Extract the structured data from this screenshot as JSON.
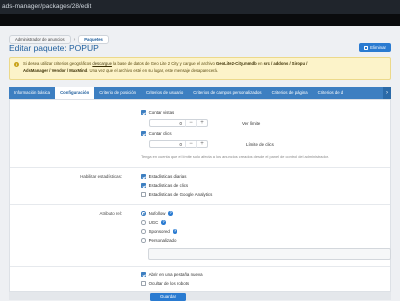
{
  "browser": {
    "url": "ads-manager/packages/28/edit"
  },
  "breadcrumb": {
    "items": [
      "Administrador de anuncios",
      "Paquetes"
    ]
  },
  "page": {
    "title": "Editar paquete: POPUP",
    "delete_label": "Eliminar"
  },
  "notice": {
    "part1": "Si desea utilizar criterios geográficos ",
    "link": "descargue",
    "part2": " la base de datos de Geo Lite 2 City y cargue el archivo ",
    "file": "GeoLite2-City.mmdb",
    "part3": " en ",
    "path1": "src / addons / Siropu /",
    "path2": "AdsManager / Vendor / MaxMind",
    "part4": ". Una vez que el archivo esté en su lugar, este mensaje desaparecerá."
  },
  "tabs": [
    "Información básica",
    "Configuración",
    "Criterio de posición",
    "Criterios de usuario",
    "Criterios de campos personalizados",
    "Criterios de página",
    "Criterios de d"
  ],
  "form": {
    "count_views": {
      "label": "Contar vistas",
      "checked": true,
      "value": "0",
      "suffix": "Ver límite"
    },
    "count_clicks": {
      "label": "Contar clics",
      "checked": true,
      "value": "0",
      "suffix": "Límite de clics"
    },
    "limit_hint": "Tenga en cuenta que el límite solo afecta a los anuncios creados desde el panel de control del administrador.",
    "stats": {
      "label": "Habilitar estadísticas:",
      "options": [
        {
          "label": "Estadísticas diarias",
          "checked": true
        },
        {
          "label": "Estadísticas de clics",
          "checked": true
        },
        {
          "label": "Estadísticas de Google Analytics",
          "checked": false
        }
      ]
    },
    "rel": {
      "label": "Atributo rel:",
      "options": [
        {
          "label": "Nofollow",
          "selected": true
        },
        {
          "label": "UGC",
          "selected": false
        },
        {
          "label": "Sponsored",
          "selected": false
        },
        {
          "label": "Personalizado",
          "selected": false
        }
      ],
      "custom_value": ""
    },
    "new_tab": {
      "label": "Abrir en una pestaña nueva",
      "checked": true
    },
    "hide_robots": {
      "label": "Ocultar de los robots",
      "checked": false
    }
  },
  "save_label": "Guardar",
  "colors": {
    "accent": "#3d7fc1",
    "button": "#2a7bd1",
    "title": "#1d5d9c",
    "notice_bg": "#fcf3c9"
  }
}
